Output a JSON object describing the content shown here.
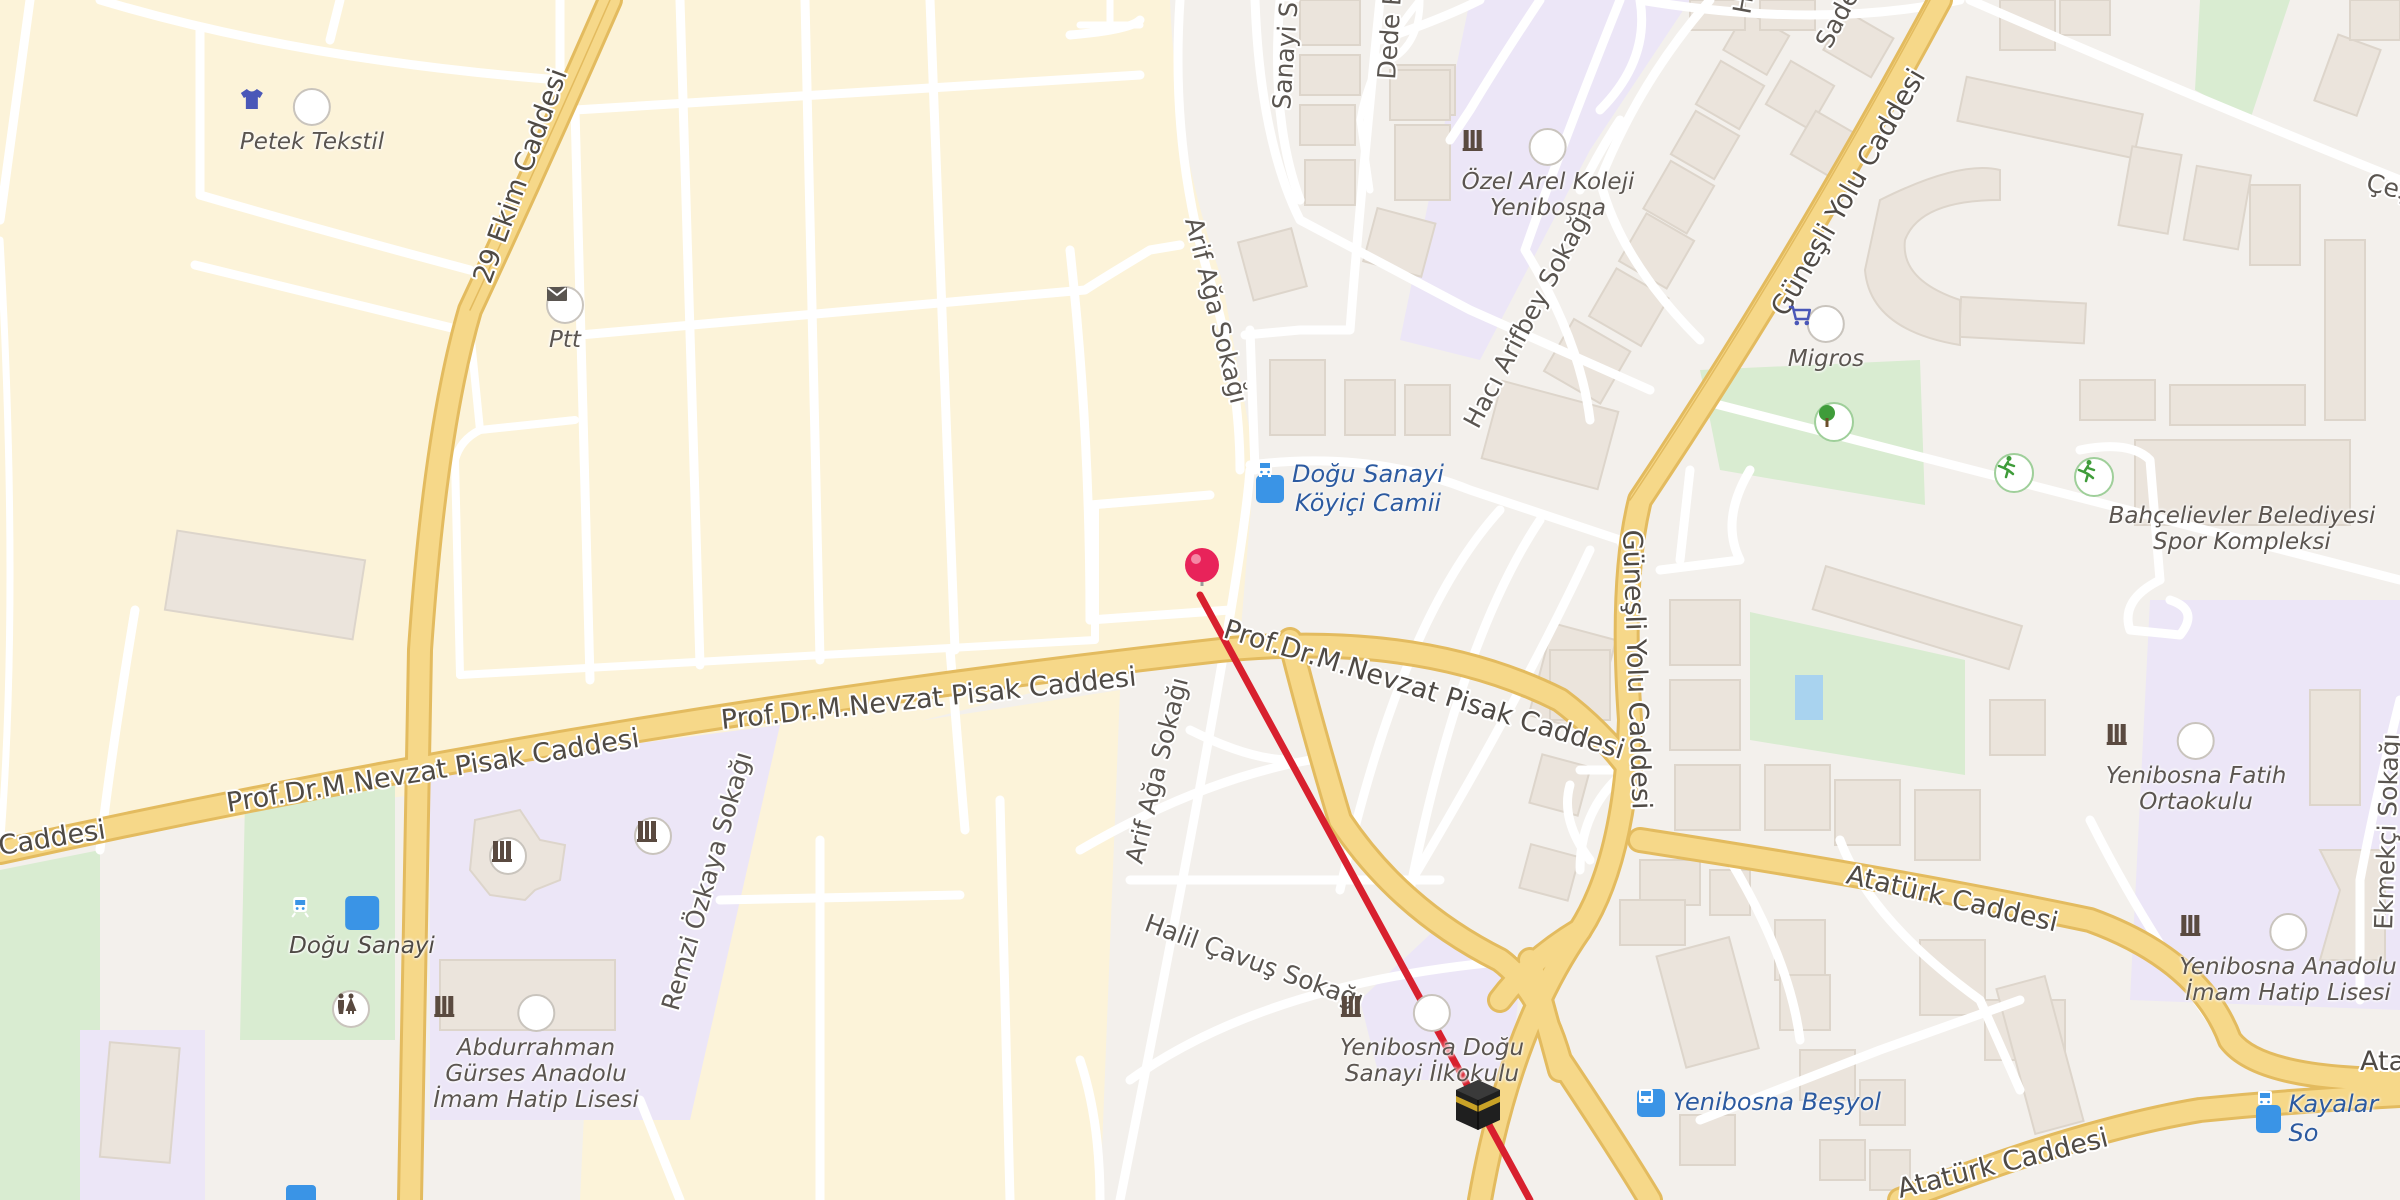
{
  "map": {
    "colors": {
      "residential": "#fcf3d9",
      "built_area": "#f3f0ec",
      "education": "#ece6f7",
      "park": "#d9ecd1",
      "primary_road": "#f6d889",
      "primary_road_edge": "#e3bb5f",
      "minor_road": "#ffffff",
      "building": "#ece6df",
      "route_line": "#d8202e",
      "transit_blue": "#3a94e6",
      "label_blue": "#2c5aa0"
    },
    "streets": {
      "caddesi_29_ekim": "29 Ekim Caddesi",
      "nevzat_pisak_left": "Prof.Dr.M.Nevzat Pisak Caddesi",
      "nevzat_pisak_mid": "Prof.Dr.M.Nevzat Pisak Caddesi",
      "nevzat_pisak_right": "Prof.Dr.M.Nevzat Pisak Caddesi",
      "caddesi_left_edge": "Caddesi",
      "arif_aga_upper": "Arif Ağa Sokağı",
      "arif_aga_lower": "Arif Ağa Sokağı",
      "sanayi_sitesi": "Sanayi Sit",
      "dede_e": "Dede E",
      "haci_arifbey": "Hacı Arifbey Sokağı",
      "gunesli_yolu_upper": "Güneşli Yolu Caddesi",
      "gunesli_yolu_lower": "Güneşli Yolu Caddesi",
      "remzi_ozkaya": "Remzi Özkaya Sokağı",
      "halil_cavus": "Halil Çavuş Sokağı",
      "ataturk_main": "Atatürk Caddesi",
      "ataturk_bottom": "Atatürk Caddesi",
      "ataturk_right": "Ata",
      "ekmekci": "Ekmekçi Sokağı",
      "ces": "Çeş",
      "sade": "Sade",
      "h_top": "H"
    },
    "pois": {
      "petek_tekstil": "Petek Tekstil",
      "ptt": "Ptt",
      "ozel_arel_line1": "Özel Arel Koleji",
      "ozel_arel_line2": "Yenibosna",
      "migros": "Migros",
      "bahcelievler_line1": "Bahçelievler Belediyesi",
      "bahcelievler_line2": "Spor Kompleksi",
      "fatih_line1": "Yenibosna Fatih",
      "fatih_line2": "Ortaokulu",
      "anadolu_line1": "Yenibosna Anadolu",
      "anadolu_line2": "İmam Hatip Lisesi",
      "ilkokulu_line1": "Yenibosna Doğu",
      "ilkokulu_line2": "Sanayi İlkokulu",
      "abdurrahman_line1": "Abdurrahman",
      "abdurrahman_line2": "Gürses Anadolu",
      "abdurrahman_line3": "İmam Hatip Lisesi"
    },
    "transit": {
      "dogu_sanayi_camii_line1": "Doğu Sanayi",
      "dogu_sanayi_camii_line2": "Köyiçi Camii",
      "dogu_sanayi_station": "Doğu Sanayi",
      "yenibosna_besyol": "Yenibosna Beşyol",
      "kayalar": "Kayalar So"
    },
    "icons": {
      "school": "school-icon",
      "shop": "shirt-icon",
      "post": "mail-icon",
      "supermarket": "cart-icon",
      "park": "tree-icon",
      "sport": "running-icon",
      "bus": "bus-icon",
      "train": "train-icon",
      "parking": "parking-icon",
      "toilets": "toilets-icon",
      "mosque_destination": "kaaba-icon",
      "location_pin": "pin-icon"
    }
  }
}
